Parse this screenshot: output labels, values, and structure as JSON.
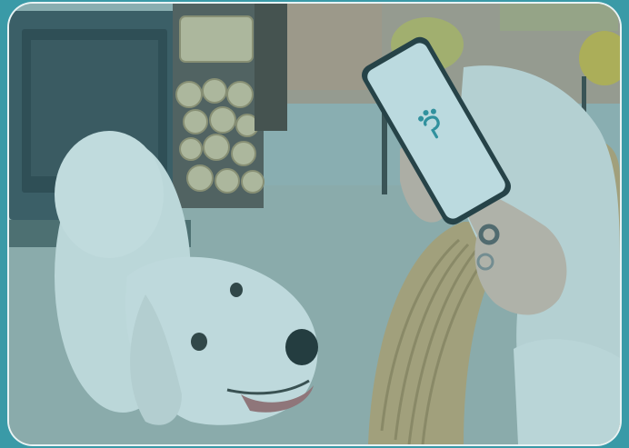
{
  "scene": {
    "description_icon": "paw-logo-icon",
    "frame_color": "#3a9aa7",
    "tint_color": "#3a96a5"
  },
  "phone": {
    "logo_icon": "paw-logo-icon",
    "screen_color": "#eef4f5",
    "logo_color": "#2f8f9c"
  }
}
